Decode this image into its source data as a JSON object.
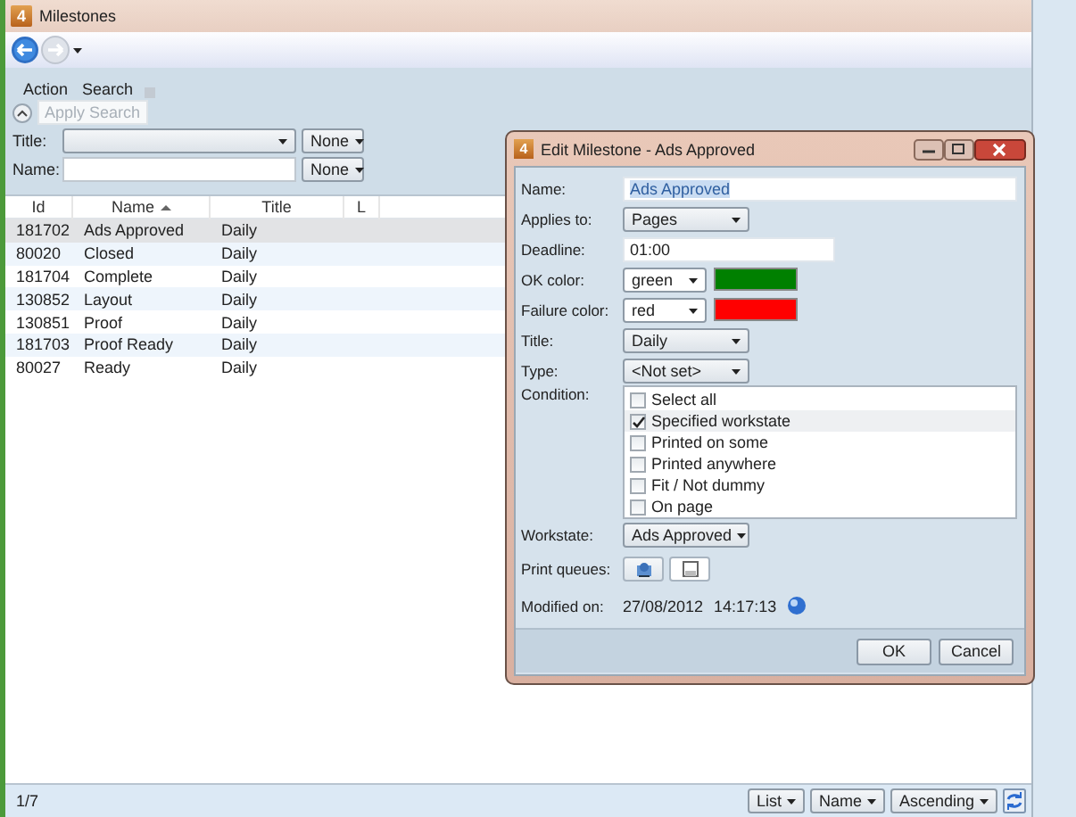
{
  "window": {
    "title": "Milestones",
    "icon_text": "4"
  },
  "menu": [
    {
      "label": "Action"
    },
    {
      "label": "Search"
    }
  ],
  "search": {
    "apply_label": "Apply Search",
    "disabled": true,
    "fields": [
      {
        "kind": "combo",
        "label": "Title:",
        "mode": "None"
      },
      {
        "kind": "text",
        "label": "Name:",
        "mode": "None"
      }
    ]
  },
  "table": {
    "columns": [
      {
        "label": "Id",
        "sorted": false
      },
      {
        "label": "Name",
        "sorted": true
      },
      {
        "label": "Title",
        "sorted": false
      },
      {
        "label": "L",
        "sorted": false
      }
    ],
    "rows": [
      {
        "cells": [
          "181702",
          "Ads Approved",
          "Daily"
        ],
        "selected": true
      },
      {
        "cells": [
          "80020",
          "Closed",
          "Daily"
        ],
        "selected": false
      },
      {
        "cells": [
          "181704",
          "Complete",
          "Daily"
        ],
        "selected": false
      },
      {
        "cells": [
          "130852",
          "Layout",
          "Daily"
        ],
        "selected": false
      },
      {
        "cells": [
          "130851",
          "Proof",
          "Daily"
        ],
        "selected": false
      },
      {
        "cells": [
          "181703",
          "Proof Ready",
          "Daily"
        ],
        "selected": false
      },
      {
        "cells": [
          "80027",
          "Ready",
          "Daily"
        ],
        "selected": false
      }
    ]
  },
  "status_bar": {
    "count": "1/7",
    "view": "List",
    "sort_by": "Name",
    "order": "Ascending"
  },
  "dialog": {
    "title": "Edit Milestone - Ads Approved",
    "icon_text": "4",
    "fields": [
      {
        "kind": "text",
        "label": "Name:",
        "value": "Ads Approved",
        "highlighted": true
      },
      {
        "kind": "combo",
        "label": "Applies to:",
        "value": "Pages"
      },
      {
        "kind": "short_text",
        "label": "Deadline:",
        "value": "01:00",
        "highlighted": false
      },
      {
        "kind": "color",
        "label": "OK color:",
        "value": "green",
        "color": "#008000"
      },
      {
        "kind": "color",
        "label": "Failure color:",
        "value": "red",
        "color": "#ff0000"
      },
      {
        "kind": "combo",
        "label": "Title:",
        "value": "Daily"
      },
      {
        "kind": "combo",
        "label": "Type:",
        "value": "<Not set>"
      },
      {
        "kind": "checklist",
        "label": "Condition:",
        "items": [
          {
            "label": "Select all",
            "checked": false
          },
          {
            "label": "Specified workstate",
            "checked": true
          },
          {
            "label": "Printed on some",
            "checked": false
          },
          {
            "label": "Printed anywhere",
            "checked": false
          },
          {
            "label": "Fit / Not dummy",
            "checked": false
          },
          {
            "label": "On page",
            "checked": false
          }
        ]
      },
      {
        "kind": "combo",
        "label": "Workstate:",
        "value": "Ads Approved"
      },
      {
        "kind": "queues",
        "label": "Print queues:"
      },
      {
        "kind": "info",
        "label": "Modified on:",
        "date": "27/08/2012",
        "time": "14:17:13"
      }
    ],
    "buttons": [
      "OK",
      "Cancel"
    ]
  }
}
